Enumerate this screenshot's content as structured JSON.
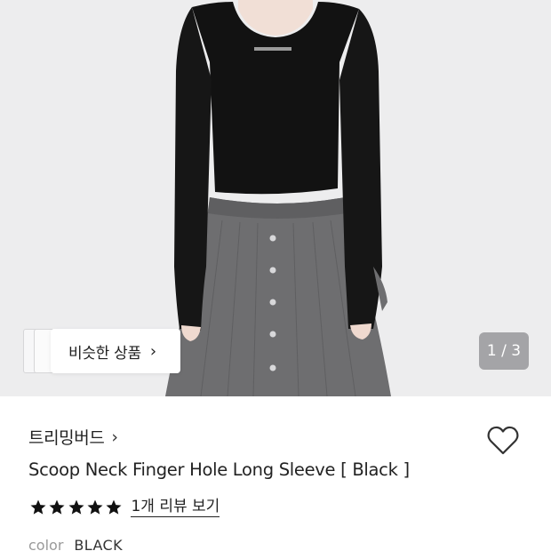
{
  "hero": {
    "similar_products_label": "비슷한 상품",
    "image_counter": "1 / 3"
  },
  "product": {
    "brand": "트리밍버드",
    "title": "Scoop Neck Finger Hole Long Sleeve [ Black ]",
    "rating_stars": 5,
    "review_link": "1개 리뷰 보기",
    "option_label": "color",
    "option_value": "BLACK"
  },
  "colors": {
    "hero_background": "#ededee",
    "top_color": "#111111",
    "skirt_color": "#6b6b6d",
    "counter_background": "#78787a",
    "star_color": "#111111"
  },
  "icons": {
    "chevron": "chevron-right-icon",
    "wishlist": "heart-outline-icon",
    "star": "star-filled-icon"
  }
}
